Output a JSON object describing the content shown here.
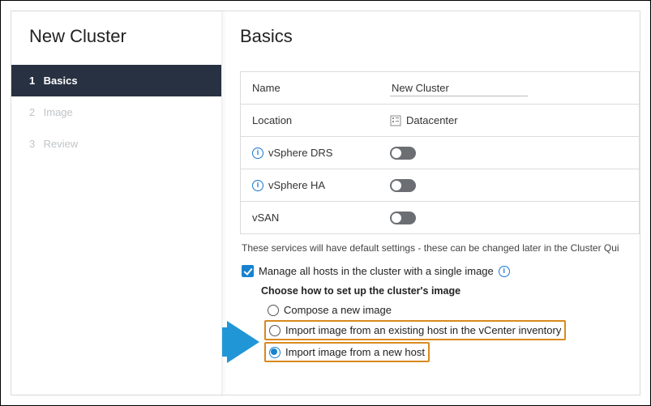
{
  "sidebar": {
    "title": "New Cluster",
    "steps": [
      {
        "num": "1",
        "label": "Basics"
      },
      {
        "num": "2",
        "label": "Image"
      },
      {
        "num": "3",
        "label": "Review"
      }
    ]
  },
  "main": {
    "title": "Basics",
    "fields": {
      "name_label": "Name",
      "name_value": "New Cluster",
      "location_label": "Location",
      "location_value": "Datacenter",
      "drs_label": "vSphere DRS",
      "ha_label": "vSphere HA",
      "vsan_label": "vSAN"
    },
    "note": "These services will have default settings - these can be changed later in the Cluster Qui",
    "manage_label": "Manage all hosts in the cluster with a single image",
    "subhead": "Choose how to set up the cluster's image",
    "options": {
      "compose": "Compose a new image",
      "import_existing": "Import image from an existing host in the vCenter inventory",
      "import_new": "Import image from a new host"
    }
  }
}
